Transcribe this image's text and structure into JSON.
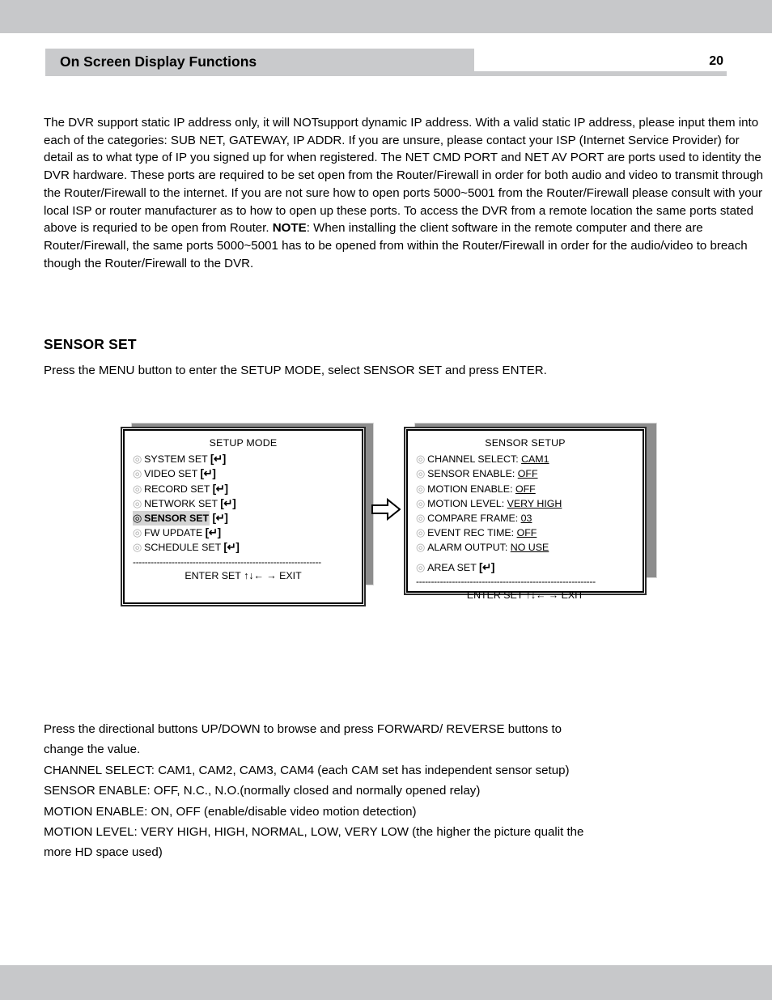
{
  "page": {
    "header_title": "On Screen Display Functions",
    "page_number": "20"
  },
  "content": {
    "intro_paragraph_part1": "The DVR support static IP address only, it will NOTsupport dynamic IP address. With a valid static IP address, please input them into each of the categories: SUB NET, GATEWAY, IP ADDR. If you are unsure, please contact your ISP (Internet Service Provider) for detail as to what type of IP you signed up for when registered. The NET CMD PORT and NET AV PORT are ports used to identity the DVR hardware. These ports are required to be set open from the Router/Firewall in order for both audio and video to transmit through the Router/Firewall to the internet. If you are not sure how to open ports 5000~5001 from the Router/Firewall please consult with your local ISP or router manufacturer as to how to open up these ports. To access the DVR from a remote location the same ports stated above is requried to be open from Router. ",
    "note_label": "NOTE",
    "intro_paragraph_part2": ": When installing the client software in the remote computer and there are Router/Firewall, the same ports 5000~5001 has to be opened from within the Router/Firewall in order for the audio/video to breach though the Router/Firewall to the DVR.",
    "sensor_set_heading": "SENSOR SET",
    "sensor_set_intro": "Press the MENU button to enter the SETUP MODE, select SENSOR SET and press ENTER.",
    "bottom_lines": [
      "Press the directional buttons UP/DOWN to browse and press FORWARD/ REVERSE buttons to",
      "change the value.",
      "CHANNEL SELECT: CAM1, CAM2, CAM3, CAM4 (each CAM set has independent sensor setup)",
      "SENSOR ENABLE: OFF, N.C., N.O.(normally closed and normally opened relay)",
      "MOTION ENABLE: ON, OFF (enable/disable video motion detection)",
      "MOTION LEVEL: VERY HIGH, HIGH, NORMAL, LOW, VERY LOW (the higher the picture qualit the",
      "more HD space used)"
    ]
  },
  "osd_setup_mode": {
    "title": "SETUP MODE",
    "bullet_glyph": "◎",
    "enter_glyph": "↵",
    "items": [
      {
        "label": "SYSTEM SET",
        "suffix": "[↵]",
        "selected": false
      },
      {
        "label": "VIDEO SET",
        "suffix": "[↵]",
        "selected": false
      },
      {
        "label": "RECORD SET",
        "suffix": "[↵]",
        "selected": false
      },
      {
        "label": "NETWORK SET",
        "suffix": "[↵]",
        "selected": false
      },
      {
        "label": "SENSOR SET",
        "suffix": "[↵]",
        "selected": true
      },
      {
        "label": "FW UPDATE",
        "suffix": "[↵]",
        "selected": false
      },
      {
        "label": "SCHEDULE SET",
        "suffix": "[↵]",
        "selected": false
      }
    ],
    "divider": "---------------------------------------------------------------",
    "footer": "ENTER SET ↑↓← → EXIT"
  },
  "osd_sensor_setup": {
    "title": "SENSOR SETUP",
    "bullet_glyph": "◎",
    "items": [
      {
        "label": "CHANNEL SELECT:",
        "value": "CAM1"
      },
      {
        "label": "SENSOR ENABLE:",
        "value": "OFF"
      },
      {
        "label": "MOTION ENABLE:",
        "value": "OFF"
      },
      {
        "label": "MOTION LEVEL:",
        "value": "VERY HIGH"
      },
      {
        "label": "COMPARE FRAME:",
        "value": "03"
      },
      {
        "label": "EVENT REC TIME:",
        "value": "OFF"
      },
      {
        "label": "ALARM OUTPUT:",
        "value": "NO USE"
      }
    ],
    "area_set_label": "AREA SET",
    "area_set_suffix": "[↵]",
    "divider": "------------------------------------------------------------",
    "footer": "ENTER SET ↑↓← → EXIT"
  },
  "colors": {
    "page_band": "#c7c8ca",
    "header_bar": "#c9cacc",
    "selected_row": "#d4d4d4",
    "shadow": "#8d8d8d"
  }
}
